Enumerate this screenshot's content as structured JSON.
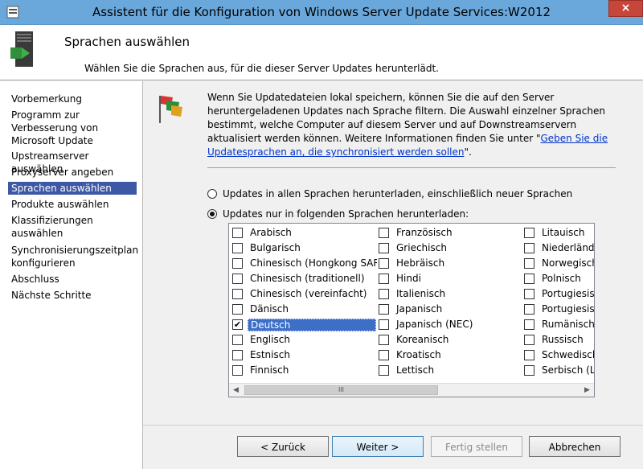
{
  "window": {
    "title": "Assistent für die Konfiguration von Windows Server Update Services:W2012",
    "close_label": "×"
  },
  "header": {
    "title": "Sprachen auswählen",
    "subtitle": "Wählen Sie die Sprachen aus, für die dieser Server Updates herunterlädt."
  },
  "nav": {
    "items": [
      {
        "label": "Vorbemerkung",
        "selected": false
      },
      {
        "label": "Programm zur Verbesserung von Microsoft Update",
        "selected": false
      },
      {
        "label": "Upstreamserver auswählen",
        "selected": false
      },
      {
        "label": "Proxyserver angeben",
        "selected": false
      },
      {
        "label": "Sprachen auswählen",
        "selected": true
      },
      {
        "label": "Produkte auswählen",
        "selected": false
      },
      {
        "label": "Klassifizierungen auswählen",
        "selected": false
      },
      {
        "label": "Synchronisierungszeitplan konfigurieren",
        "selected": false
      },
      {
        "label": "Abschluss",
        "selected": false
      },
      {
        "label": "Nächste Schritte",
        "selected": false
      }
    ]
  },
  "intro": {
    "text": "Wenn Sie Updatedateien lokal speichern, können Sie die auf den Server heruntergeladenen Updates nach Sprache filtern. Die Auswahl einzelner Sprachen bestimmt, welche Computer auf diesem Server und auf Downstreamservern aktualisiert werden können. Weitere Informationen finden Sie unter \"",
    "link": "Geben Sie die Updatesprachen an, die synchronisiert werden sollen",
    "suffix": "\"."
  },
  "options": {
    "all_languages": {
      "label": "Updates in allen Sprachen herunterladen, einschließlich neuer Sprachen",
      "selected": false
    },
    "selected_languages": {
      "label": "Updates nur in folgenden Sprachen herunterladen:",
      "selected": true
    }
  },
  "languages": {
    "columns": [
      [
        {
          "name": "Arabisch",
          "checked": false
        },
        {
          "name": "Bulgarisch",
          "checked": false
        },
        {
          "name": "Chinesisch (Hongkong SAR)",
          "checked": false
        },
        {
          "name": "Chinesisch (traditionell)",
          "checked": false
        },
        {
          "name": "Chinesisch (vereinfacht)",
          "checked": false
        },
        {
          "name": "Dänisch",
          "checked": false
        },
        {
          "name": "Deutsch",
          "checked": true,
          "highlighted": true
        },
        {
          "name": "Englisch",
          "checked": false
        },
        {
          "name": "Estnisch",
          "checked": false
        },
        {
          "name": "Finnisch",
          "checked": false
        }
      ],
      [
        {
          "name": "Französisch",
          "checked": false
        },
        {
          "name": "Griechisch",
          "checked": false
        },
        {
          "name": "Hebräisch",
          "checked": false
        },
        {
          "name": "Hindi",
          "checked": false
        },
        {
          "name": "Italienisch",
          "checked": false
        },
        {
          "name": "Japanisch",
          "checked": false
        },
        {
          "name": "Japanisch (NEC)",
          "checked": false
        },
        {
          "name": "Koreanisch",
          "checked": false
        },
        {
          "name": "Kroatisch",
          "checked": false
        },
        {
          "name": "Lettisch",
          "checked": false
        }
      ],
      [
        {
          "name": "Litauisch",
          "checked": false
        },
        {
          "name": "Niederländi",
          "checked": false
        },
        {
          "name": "Norwegisch",
          "checked": false
        },
        {
          "name": "Polnisch",
          "checked": false
        },
        {
          "name": "Portugiesis",
          "checked": false
        },
        {
          "name": "Portugiesis",
          "checked": false
        },
        {
          "name": "Rumänisch",
          "checked": false
        },
        {
          "name": "Russisch",
          "checked": false
        },
        {
          "name": "Schwedisch",
          "checked": false
        },
        {
          "name": "Serbisch (La",
          "checked": false
        }
      ]
    ],
    "scroll_left": "◀",
    "scroll_right": "▶",
    "scroll_grip": "III",
    "highlight_color": "#3d6fc7"
  },
  "buttons": {
    "back": "< Zurück",
    "next": "Weiter >",
    "finish": "Fertig stellen",
    "cancel": "Abbrechen"
  },
  "colors": {
    "titlebar": "#6aa8dc",
    "nav_selected": "#3d58a5",
    "link": "#0033cc"
  }
}
